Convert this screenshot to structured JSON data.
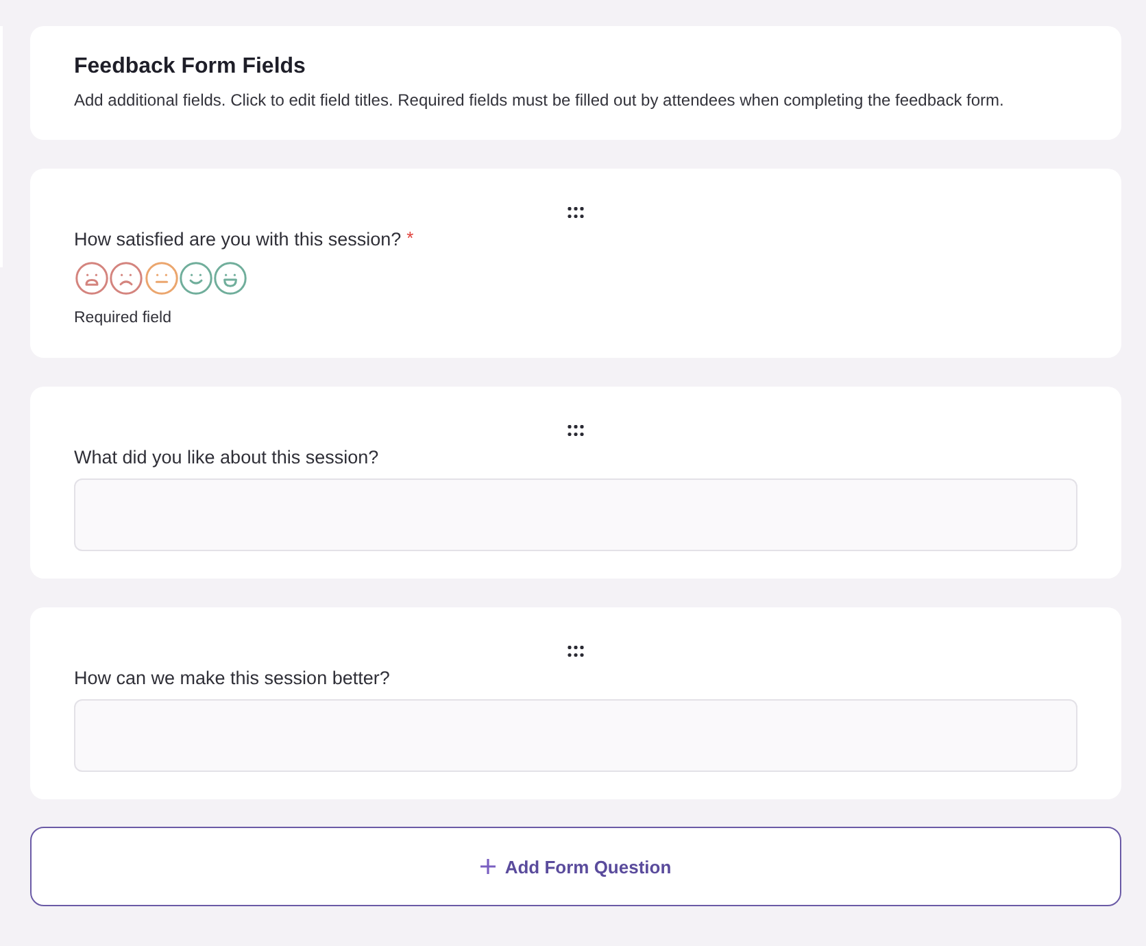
{
  "header": {
    "title": "Feedback Form Fields",
    "description": "Add additional fields. Click to edit field titles. Required fields must be filled out by attendees when completing the feedback form."
  },
  "questions": [
    {
      "kind": "rating",
      "label": "How satisfied are you with this session?",
      "required_mark": "*",
      "faces": [
        {
          "kind": "very-sad",
          "color": "#d4847e"
        },
        {
          "kind": "sad",
          "color": "#d4847e"
        },
        {
          "kind": "neutral",
          "color": "#eba66e"
        },
        {
          "kind": "happy",
          "color": "#70ae9b"
        },
        {
          "kind": "very-happy",
          "color": "#70ae9b"
        }
      ],
      "note": "Required field"
    },
    {
      "kind": "text",
      "label": "What did you like about this session?"
    },
    {
      "kind": "text",
      "label": "How can we make this session better?"
    }
  ],
  "add_button": {
    "label": "Add Form Question"
  }
}
